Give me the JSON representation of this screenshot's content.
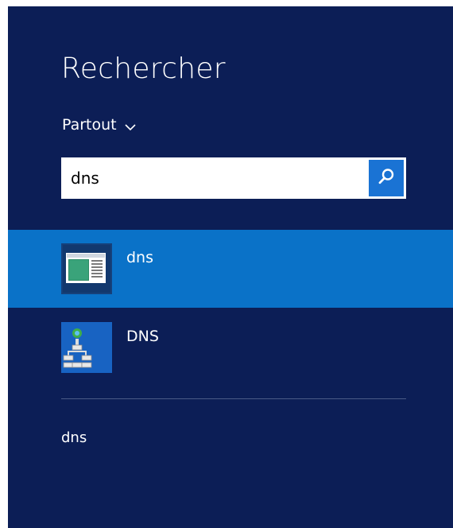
{
  "search_pane": {
    "title": "Rechercher",
    "scope_label": "Partout",
    "query": "dns"
  },
  "results": [
    {
      "label": "dns",
      "icon": "dns-file-icon",
      "selected": true
    },
    {
      "label": "DNS",
      "icon": "dns-manager-icon",
      "selected": false
    }
  ],
  "suggestions": [
    "dns"
  ],
  "colors": {
    "panel_background": "#0c1e56",
    "selected_background": "#0a72c8",
    "search_button": "#1a73d4"
  }
}
